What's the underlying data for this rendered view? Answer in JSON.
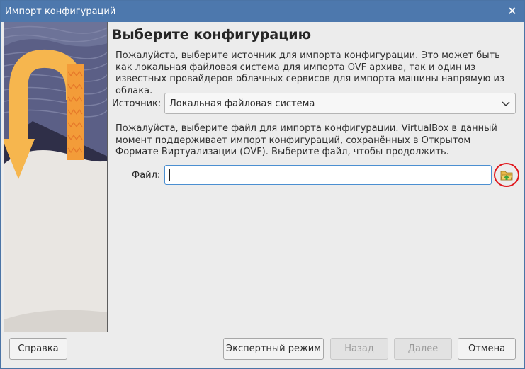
{
  "window": {
    "title": "Импорт конфигураций",
    "close_icon": "close-icon"
  },
  "page": {
    "heading": "Выберите конфигурацию",
    "intro_text": "Пожалуйста, выберите источник для импорта конфигурации. Это может быть как локальная файловая система для импорта OVF архива, так и один из известных провайдеров облачных сервисов для импорта машины напрямую из облака.",
    "source_label": "Источник:",
    "source_value": "Локальная файловая система",
    "file_text": "Пожалуйста, выберите файл для импорта конфигурации. VirtualBox в данный момент поддерживает импорт конфигураций, сохранённых в Открытом Формате Виртуализации (OVF). Выберите файл, чтобы продолжить.",
    "file_label": "Файл:",
    "file_value": "",
    "folder_icon": "folder-open-icon"
  },
  "buttons": {
    "help": "Справка",
    "expert": "Экспертный режим",
    "back": "Назад",
    "next": "Далее",
    "cancel": "Отмена"
  },
  "colors": {
    "titlebar": "#4d78ad",
    "arrow": "#f6b64e",
    "highlight_circle": "#e0161b",
    "input_focus": "#4b8fd1"
  }
}
